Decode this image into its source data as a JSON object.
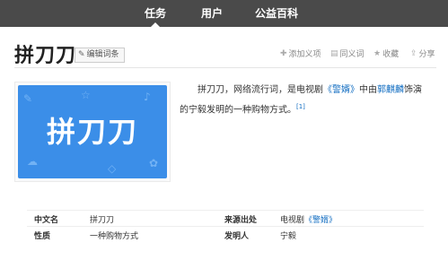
{
  "nav": {
    "items": [
      {
        "label": "任务"
      },
      {
        "label": "用户"
      },
      {
        "label": "公益百科"
      }
    ]
  },
  "entry": {
    "title": "拼刀刀",
    "edit_label": "编辑词条"
  },
  "actions": {
    "add_meaning": "添加义项",
    "synonyms": "同义词",
    "favorite": "收藏",
    "share": "分享"
  },
  "image": {
    "text": "拼刀刀",
    "bg_color": "#3b8ee8"
  },
  "summary": {
    "p1": "拼刀刀，网络流行词，是电视剧",
    "link1": "《警婿》",
    "p2": "中由",
    "link2": "郭麒麟",
    "p3": "饰演的宁毅发明的一种购物方式。",
    "ref": "[1]"
  },
  "info": {
    "chinese_name_label": "中文名",
    "chinese_name_value": "拼刀刀",
    "nature_label": "性质",
    "nature_value": "一种购物方式",
    "source_label": "来源出处",
    "source_prefix": "电视剧",
    "source_link": "《警婿》",
    "inventor_label": "发明人",
    "inventor_value": "宁毅"
  },
  "colors": {
    "nav_bg": "#4a4a4a",
    "link": "#136ec2",
    "image_bg": "#3b8ee8"
  }
}
